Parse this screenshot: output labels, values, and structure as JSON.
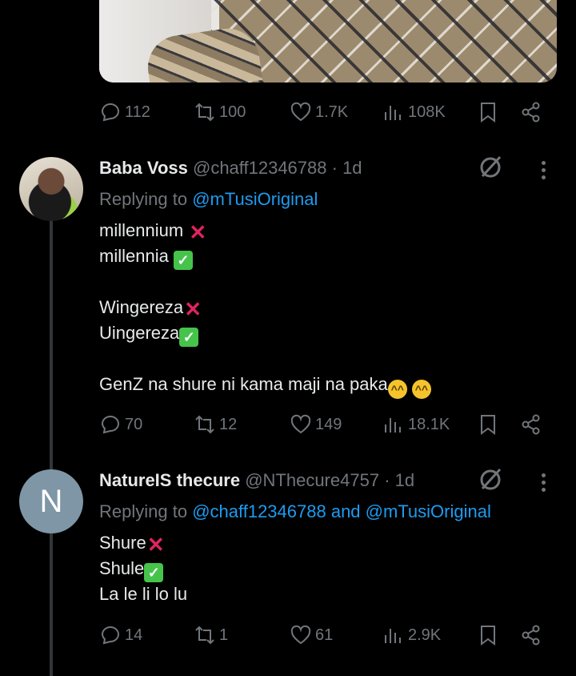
{
  "top_post": {
    "stats": {
      "replies": "112",
      "reposts": "100",
      "likes": "1.7K",
      "views": "108K"
    }
  },
  "replies": [
    {
      "name": "Baba Voss",
      "handle": "@chaff12346788",
      "time": "· 1d",
      "replying_prefix": "Replying to",
      "mentions": "@mTusiOriginal",
      "lines": [
        "millennium",
        "millennia",
        "",
        "Wingereza",
        "Uingereza",
        "",
        "GenZ na shure ni kama maji na paka"
      ],
      "stats": {
        "replies": "70",
        "reposts": "12",
        "likes": "149",
        "views": "18.1K"
      }
    },
    {
      "avatar_letter": "N",
      "name": "NatureIS thecure",
      "handle": "@NThecure4757",
      "time": "· 1d",
      "replying_prefix": "Replying to",
      "mentions": "@chaff12346788 and @mTusiOriginal",
      "lines": [
        "Shure",
        "Shule",
        "La le li lo lu"
      ],
      "stats": {
        "replies": "14",
        "reposts": "1",
        "likes": "61",
        "views": "2.9K"
      }
    }
  ],
  "colors": {
    "background": "#000000",
    "text": "#e7e9ea",
    "muted": "#71767b",
    "link": "#1d9bf0"
  },
  "icons": [
    "reply-icon",
    "repost-icon",
    "like-icon",
    "views-icon",
    "bookmark-icon",
    "share-icon",
    "grok-icon",
    "more-icon"
  ]
}
